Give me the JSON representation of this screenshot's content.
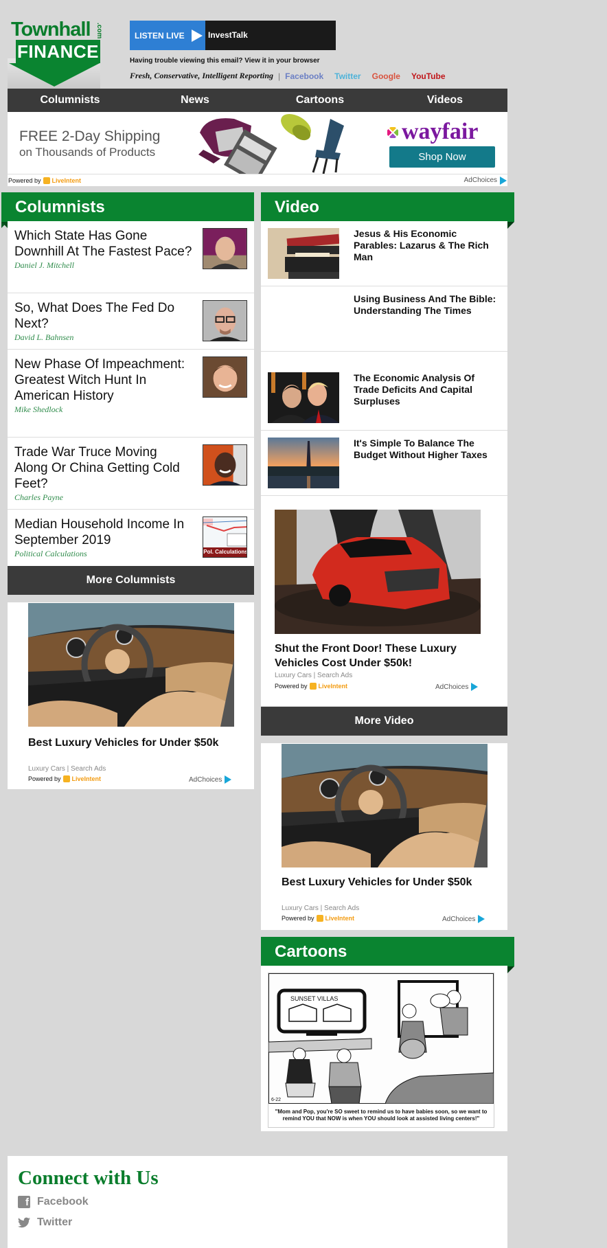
{
  "header": {
    "logo": {
      "line1": "Townhall",
      "dotcom": ".com",
      "line2": "FINANCE"
    },
    "listen_live": {
      "label": "LISTEN LIVE",
      "station": "InvestTalk"
    },
    "trouble_text": "Having trouble viewing this email? View it in your browser",
    "tagline": "Fresh, Conservative, Intelligent Reporting",
    "separator": "|",
    "social": [
      {
        "label": "Facebook",
        "color": "#6b7fc4"
      },
      {
        "label": "Twitter",
        "color": "#4fb3d9"
      },
      {
        "label": "Google",
        "color": "#d9533f"
      },
      {
        "label": "YouTube",
        "color": "#c0161a"
      }
    ]
  },
  "nav": {
    "items": [
      "Columnists",
      "News",
      "Cartoons",
      "Videos"
    ]
  },
  "banner_ad": {
    "line1": "FREE 2-Day Shipping",
    "line2": "on Thousands of Products",
    "brand": "wayfair",
    "cta": "Shop Now",
    "powered_by": "Powered by",
    "liveintent": "LiveIntent",
    "adchoices": "AdChoices"
  },
  "columnists": {
    "title": "Columnists",
    "items": [
      {
        "title": "Which State Has Gone Downhill At The Fastest Pace?",
        "author": "Daniel J. Mitchell"
      },
      {
        "title": "So, What Does The Fed Do Next?",
        "author": "David L. Bahnsen"
      },
      {
        "title": "New Phase Of Impeachment: Greatest Witch Hunt In American History",
        "author": "Mike Shedlock"
      },
      {
        "title": "Trade War Truce Moving Along Or China Getting Cold Feet?",
        "author": "Charles Payne"
      },
      {
        "title": "Median Household Income In September 2019",
        "author": "Political Calculations",
        "thumb_label": "Pol. Calculations"
      }
    ],
    "more_label": "More Columnists"
  },
  "video": {
    "title": "Video",
    "items": [
      {
        "title": "Jesus & His Economic Parables: Lazarus & The Rich Man"
      },
      {
        "title": "Using Business And The Bible: Understanding The Times"
      },
      {
        "title": "The Economic Analysis Of Trade Deficits And Capital Surpluses"
      },
      {
        "title": "It's Simple To Balance The Budget Without Higher Taxes"
      }
    ],
    "more_label": "More Video"
  },
  "ads": {
    "video_ad": {
      "title": "Shut the Front Door! These Luxury Vehicles Cost Under $50k!",
      "source": "Luxury Cars | Search Ads"
    },
    "left_ad": {
      "title": "Best Luxury Vehicles for Under $50k",
      "source": "Luxury Cars | Search Ads"
    },
    "right_ad": {
      "title": "Best Luxury Vehicles for Under $50k",
      "source": "Luxury Cars | Search Ads"
    },
    "powered_by": "Powered by",
    "liveintent": "LiveIntent",
    "adchoices": "AdChoices"
  },
  "cartoons": {
    "title": "Cartoons",
    "tv_text": "SUNSET VILLAS",
    "caption": "\"Mom and Pop, you're SO sweet to remind us to have babies soon, so we want to remind YOU that NOW is when YOU should look at assisted living centers!\"",
    "date": "6-22"
  },
  "connect": {
    "title": "Connect with Us",
    "links": [
      "Facebook",
      "Twitter"
    ]
  }
}
